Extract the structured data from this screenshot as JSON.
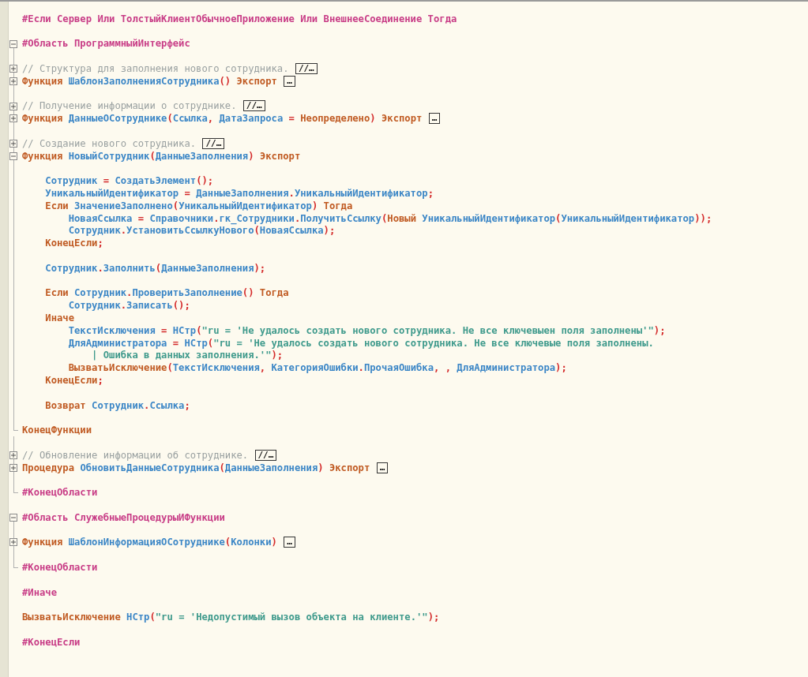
{
  "lines": [
    {
      "kind": "code",
      "tokens": [
        {
          "kind": "pp",
          "text": "#Если Сервер Или ТолстыйКлиентОбычноеПриложение Или ВнешнееСоединение Тогда"
        }
      ]
    },
    {
      "kind": "blank"
    },
    {
      "kind": "code",
      "expanded": true,
      "tokens": [
        {
          "kind": "pp",
          "text": "#Область ПрограммныйИнтерфейс"
        }
      ]
    },
    {
      "kind": "blank"
    },
    {
      "kind": "code",
      "expanded": false,
      "tokens": [
        {
          "kind": "c",
          "text": "// Структура для заполнения нового сотрудника. "
        },
        {
          "kind": "fold",
          "text": "//…"
        }
      ]
    },
    {
      "kind": "code",
      "expanded": false,
      "tokens": [
        {
          "kind": "kw",
          "text": "Функция "
        },
        {
          "kind": "id",
          "text": "ШаблонЗаполненияСотрудника"
        },
        {
          "kind": "op",
          "text": "() "
        },
        {
          "kind": "kw",
          "text": "Экспорт "
        },
        {
          "kind": "fold",
          "text": "…"
        }
      ]
    },
    {
      "kind": "blank"
    },
    {
      "kind": "code",
      "expanded": false,
      "tokens": [
        {
          "kind": "c",
          "text": "// Получение информации о сотруднике. "
        },
        {
          "kind": "fold",
          "text": "//…"
        }
      ]
    },
    {
      "kind": "code",
      "expanded": false,
      "tokens": [
        {
          "kind": "kw",
          "text": "Функция "
        },
        {
          "kind": "id",
          "text": "ДанныеОСотруднике"
        },
        {
          "kind": "op",
          "text": "("
        },
        {
          "kind": "id",
          "text": "Ссылка"
        },
        {
          "kind": "op",
          "text": ", "
        },
        {
          "kind": "id",
          "text": "ДатаЗапроса"
        },
        {
          "kind": "op",
          "text": " = "
        },
        {
          "kind": "kw",
          "text": "Неопределено"
        },
        {
          "kind": "op",
          "text": ") "
        },
        {
          "kind": "kw",
          "text": "Экспорт "
        },
        {
          "kind": "fold",
          "text": "…"
        }
      ]
    },
    {
      "kind": "blank"
    },
    {
      "kind": "code",
      "expanded": false,
      "tokens": [
        {
          "kind": "c",
          "text": "// Создание нового сотрудника. "
        },
        {
          "kind": "fold",
          "text": "//…"
        }
      ]
    },
    {
      "kind": "code",
      "expanded": true,
      "tokens": [
        {
          "kind": "kw",
          "text": "Функция "
        },
        {
          "kind": "id",
          "text": "НовыйСотрудник"
        },
        {
          "kind": "op",
          "text": "("
        },
        {
          "kind": "id",
          "text": "ДанныеЗаполнения"
        },
        {
          "kind": "op",
          "text": ") "
        },
        {
          "kind": "kw",
          "text": "Экспорт"
        }
      ],
      "children": [
        {
          "kind": "blank"
        },
        {
          "kind": "code",
          "tokens": [
            {
              "kind": "id",
              "text": "Сотрудник"
            },
            {
              "kind": "op",
              "text": " = "
            },
            {
              "kind": "id",
              "text": "СоздатьЭлемент"
            },
            {
              "kind": "op",
              "text": "();"
            }
          ]
        },
        {
          "kind": "code",
          "tokens": [
            {
              "kind": "id",
              "text": "УникальныйИдентификатор"
            },
            {
              "kind": "op",
              "text": " = "
            },
            {
              "kind": "id",
              "text": "ДанныеЗаполнения"
            },
            {
              "kind": "op",
              "text": "."
            },
            {
              "kind": "id",
              "text": "УникальныйИдентификатор"
            },
            {
              "kind": "op",
              "text": ";"
            }
          ]
        },
        {
          "kind": "code",
          "tokens": [
            {
              "kind": "kw",
              "text": "Если "
            },
            {
              "kind": "id",
              "text": "ЗначениеЗаполнено"
            },
            {
              "kind": "op",
              "text": "("
            },
            {
              "kind": "id",
              "text": "УникальныйИдентификатор"
            },
            {
              "kind": "op",
              "text": ") "
            },
            {
              "kind": "kw",
              "text": "Тогда"
            }
          ],
          "children": [
            {
              "kind": "code",
              "tokens": [
                {
                  "kind": "id",
                  "text": "НоваяСсылка"
                },
                {
                  "kind": "op",
                  "text": " = "
                },
                {
                  "kind": "id",
                  "text": "Справочники"
                },
                {
                  "kind": "op",
                  "text": "."
                },
                {
                  "kind": "id",
                  "text": "гк_Сотрудники"
                },
                {
                  "kind": "op",
                  "text": "."
                },
                {
                  "kind": "id",
                  "text": "ПолучитьСсылку"
                },
                {
                  "kind": "op",
                  "text": "("
                },
                {
                  "kind": "kw",
                  "text": "Новый "
                },
                {
                  "kind": "id",
                  "text": "УникальныйИдентификатор"
                },
                {
                  "kind": "op",
                  "text": "("
                },
                {
                  "kind": "id",
                  "text": "УникальныйИдентификатор"
                },
                {
                  "kind": "op",
                  "text": "));"
                }
              ]
            },
            {
              "kind": "code",
              "tokens": [
                {
                  "kind": "id",
                  "text": "Сотрудник"
                },
                {
                  "kind": "op",
                  "text": "."
                },
                {
                  "kind": "id",
                  "text": "УстановитьСсылкуНового"
                },
                {
                  "kind": "op",
                  "text": "("
                },
                {
                  "kind": "id",
                  "text": "НоваяСсылка"
                },
                {
                  "kind": "op",
                  "text": ");"
                }
              ]
            }
          ]
        },
        {
          "kind": "code",
          "tokens": [
            {
              "kind": "kw",
              "text": "КонецЕсли"
            },
            {
              "kind": "op",
              "text": ";"
            }
          ]
        },
        {
          "kind": "blank"
        },
        {
          "kind": "code",
          "tokens": [
            {
              "kind": "id",
              "text": "Сотрудник"
            },
            {
              "kind": "op",
              "text": "."
            },
            {
              "kind": "id",
              "text": "Заполнить"
            },
            {
              "kind": "op",
              "text": "("
            },
            {
              "kind": "id",
              "text": "ДанныеЗаполнения"
            },
            {
              "kind": "op",
              "text": ");"
            }
          ]
        },
        {
          "kind": "blank"
        },
        {
          "kind": "code",
          "tokens": [
            {
              "kind": "kw",
              "text": "Если "
            },
            {
              "kind": "id",
              "text": "Сотрудник"
            },
            {
              "kind": "op",
              "text": "."
            },
            {
              "kind": "id",
              "text": "ПроверитьЗаполнение"
            },
            {
              "kind": "op",
              "text": "() "
            },
            {
              "kind": "kw",
              "text": "Тогда"
            }
          ],
          "children": [
            {
              "kind": "code",
              "tokens": [
                {
                  "kind": "id",
                  "text": "Сотрудник"
                },
                {
                  "kind": "op",
                  "text": "."
                },
                {
                  "kind": "id",
                  "text": "Записать"
                },
                {
                  "kind": "op",
                  "text": "();"
                }
              ]
            }
          ]
        },
        {
          "kind": "code",
          "tokens": [
            {
              "kind": "kw",
              "text": "Иначе"
            }
          ],
          "children": [
            {
              "kind": "code",
              "tokens": [
                {
                  "kind": "id",
                  "text": "ТекстИсключения"
                },
                {
                  "kind": "op",
                  "text": " = "
                },
                {
                  "kind": "id",
                  "text": "НСтр"
                },
                {
                  "kind": "op",
                  "text": "("
                },
                {
                  "kind": "s",
                  "text": "\"ru = 'Не удалось создать нового сотрудника. Не все ключевыен поля заполнены'\""
                },
                {
                  "kind": "op",
                  "text": ");"
                }
              ]
            },
            {
              "kind": "code",
              "tokens": [
                {
                  "kind": "id",
                  "text": "ДляАдминистратора"
                },
                {
                  "kind": "op",
                  "text": " = "
                },
                {
                  "kind": "id",
                  "text": "НСтр"
                },
                {
                  "kind": "op",
                  "text": "("
                },
                {
                  "kind": "s",
                  "text": "\"ru = 'Не удалось создать нового сотрудника. Не все ключевые поля заполнены."
                }
              ],
              "children": [
                {
                  "kind": "code",
                  "tokens": [
                    {
                      "kind": "s",
                      "text": "| Ошибка в данных заполнения.'\""
                    },
                    {
                      "kind": "op",
                      "text": ");"
                    }
                  ]
                }
              ]
            },
            {
              "kind": "code",
              "tokens": [
                {
                  "kind": "kw",
                  "text": "ВызватьИсключение"
                },
                {
                  "kind": "op",
                  "text": "("
                },
                {
                  "kind": "id",
                  "text": "ТекстИсключения"
                },
                {
                  "kind": "op",
                  "text": ", "
                },
                {
                  "kind": "id",
                  "text": "КатегорияОшибки"
                },
                {
                  "kind": "op",
                  "text": "."
                },
                {
                  "kind": "id",
                  "text": "ПрочаяОшибка"
                },
                {
                  "kind": "op",
                  "text": ", , "
                },
                {
                  "kind": "id",
                  "text": "ДляАдминистратора"
                },
                {
                  "kind": "op",
                  "text": ");"
                }
              ]
            }
          ]
        },
        {
          "kind": "code",
          "tokens": [
            {
              "kind": "kw",
              "text": "КонецЕсли"
            },
            {
              "kind": "op",
              "text": ";"
            }
          ]
        },
        {
          "kind": "blank"
        },
        {
          "kind": "code",
          "tokens": [
            {
              "kind": "kw",
              "text": "Возврат "
            },
            {
              "kind": "id",
              "text": "Сотрудник"
            },
            {
              "kind": "op",
              "text": "."
            },
            {
              "kind": "id",
              "text": "Ссылка"
            },
            {
              "kind": "op",
              "text": ";"
            }
          ]
        },
        {
          "kind": "blank"
        }
      ]
    },
    {
      "kind": "code",
      "end": true,
      "tokens": [
        {
          "kind": "kw",
          "text": "КонецФункции"
        }
      ]
    },
    {
      "kind": "blank"
    },
    {
      "kind": "code",
      "expanded": false,
      "tokens": [
        {
          "kind": "c",
          "text": "// Обновление информации об сотруднике. "
        },
        {
          "kind": "fold",
          "text": "//…"
        }
      ]
    },
    {
      "kind": "code",
      "expanded": false,
      "tokens": [
        {
          "kind": "kw",
          "text": "Процедура "
        },
        {
          "kind": "id",
          "text": "ОбновитьДанныеСотрудника"
        },
        {
          "kind": "op",
          "text": "("
        },
        {
          "kind": "id",
          "text": "ДанныеЗаполнения"
        },
        {
          "kind": "op",
          "text": ") "
        },
        {
          "kind": "kw",
          "text": "Экспорт "
        },
        {
          "kind": "fold",
          "text": "…"
        }
      ]
    },
    {
      "kind": "blank"
    },
    {
      "kind": "code",
      "end": true,
      "tokens": [
        {
          "kind": "pp",
          "text": "#КонецОбласти"
        }
      ]
    },
    {
      "kind": "blank"
    },
    {
      "kind": "code",
      "expanded": true,
      "tokens": [
        {
          "kind": "pp",
          "text": "#Область СлужебныеПроцедурыИФункции"
        }
      ]
    },
    {
      "kind": "blank"
    },
    {
      "kind": "code",
      "expanded": false,
      "tokens": [
        {
          "kind": "kw",
          "text": "Функция "
        },
        {
          "kind": "id",
          "text": "ШаблонИнформацияОСотруднике"
        },
        {
          "kind": "op",
          "text": "("
        },
        {
          "kind": "id",
          "text": "Колонки"
        },
        {
          "kind": "op",
          "text": ") "
        },
        {
          "kind": "fold",
          "text": "…"
        }
      ]
    },
    {
      "kind": "blank"
    },
    {
      "kind": "code",
      "end": true,
      "tokens": [
        {
          "kind": "pp",
          "text": "#КонецОбласти"
        }
      ]
    },
    {
      "kind": "blank"
    },
    {
      "kind": "code",
      "tokens": [
        {
          "kind": "pp",
          "text": "#Иначе"
        }
      ]
    },
    {
      "kind": "blank"
    },
    {
      "kind": "code",
      "tokens": [
        {
          "kind": "kw",
          "text": "ВызватьИсключение "
        },
        {
          "kind": "id",
          "text": "НСтр"
        },
        {
          "kind": "op",
          "text": "("
        },
        {
          "kind": "s",
          "text": "\"ru = 'Недопустимый вызов объекта на клиенте.'\""
        },
        {
          "kind": "op",
          "text": ");"
        }
      ]
    },
    {
      "kind": "blank"
    },
    {
      "kind": "code",
      "tokens": [
        {
          "kind": "pp",
          "text": "#КонецЕсли"
        }
      ]
    }
  ]
}
